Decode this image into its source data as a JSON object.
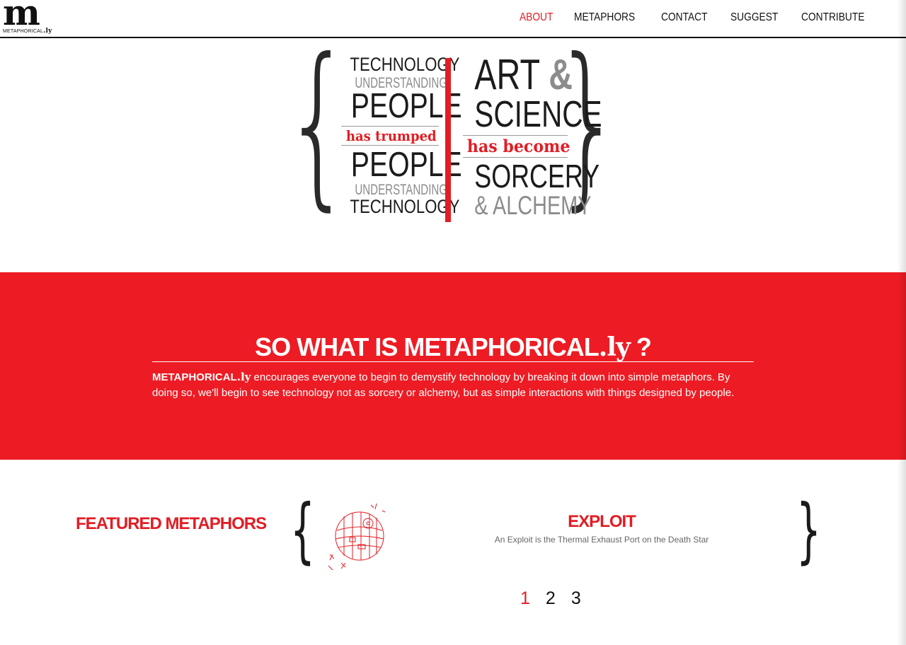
{
  "header": {
    "logo_mark": "m",
    "logo_sub_text": "METAPHORICAL",
    "logo_sub_ly": ".ly",
    "nav": [
      {
        "label": "ABOUT",
        "active": true
      },
      {
        "label": "METAPHORS",
        "active": false
      },
      {
        "label": "CONTACT",
        "active": false
      },
      {
        "label": "SUGGEST",
        "active": false
      },
      {
        "label": "CONTRIBUTE",
        "active": false
      }
    ]
  },
  "hero": {
    "left": {
      "line1": "TECHNOLOGY",
      "line2": "UNDERSTANDING",
      "line3": "PEOPLE",
      "connector": "has trumped",
      "line4": "PEOPLE",
      "line5": "UNDERSTANDING",
      "line6": "TECHNOLOGY"
    },
    "right": {
      "line1": "ART",
      "amp": "&",
      "line2": "SCIENCE",
      "connector": "has become",
      "line3": "SORCERY",
      "line4": "& ALCHEMY"
    }
  },
  "about": {
    "title_prefix": "SO WHAT IS METAPHORICAL",
    "title_ly": ".ly",
    "title_suffix": " ?",
    "brand": "METAPHORICAL",
    "brand_ly": ".ly",
    "body": " encourages everyone to begin to demystify technology by breaking it down into simple metaphors. By doing so, we'll begin to see technology not as sorcery or alchemy, but as simple interactions with things designed by people."
  },
  "featured": {
    "heading": "FEATURED METAPHORS",
    "item_title": "EXPLOIT",
    "item_desc": "An Exploit is the Thermal Exhaust Port on the Death Star",
    "illustration": "death-star-sketch",
    "pages": [
      "1",
      "2",
      "3"
    ],
    "current_page": "1"
  },
  "colors": {
    "accent": "#e21d24",
    "band": "#ed1c24",
    "text": "#1a1a1a",
    "grey": "#8c8c8c"
  }
}
